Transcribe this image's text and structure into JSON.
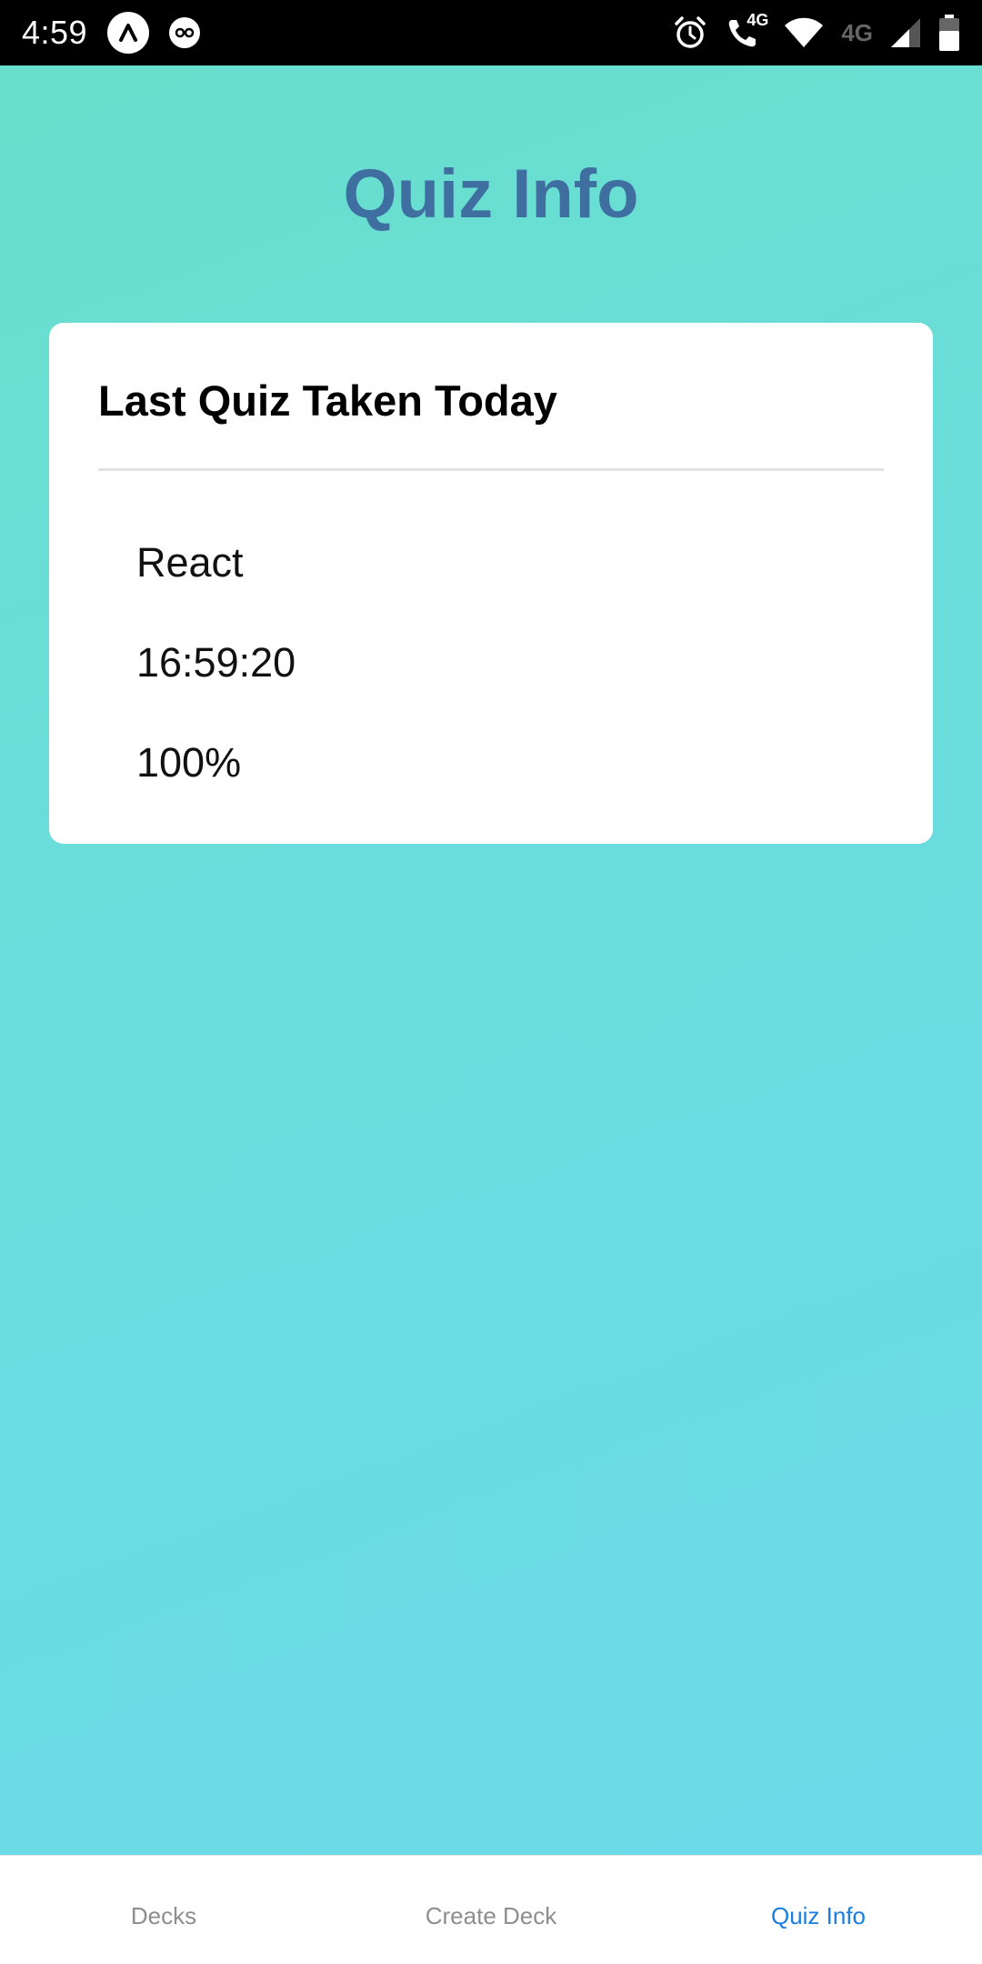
{
  "status_bar": {
    "time": "4:59",
    "left_icons": [
      "expo-icon",
      "go-icon"
    ],
    "right_icons": [
      "alarm-icon",
      "wifi-call-icon",
      "wifi-icon",
      "signal-icon",
      "battery-icon"
    ],
    "call_network": "4G",
    "network_label": "4G"
  },
  "page": {
    "title": "Quiz Info"
  },
  "card": {
    "title": "Last Quiz Taken Today",
    "deck": "React",
    "time": "16:59:20",
    "score": "100%"
  },
  "tabs": [
    {
      "label": "Decks",
      "active": false
    },
    {
      "label": "Create Deck",
      "active": false
    },
    {
      "label": "Quiz Info",
      "active": true
    }
  ],
  "colors": {
    "title": "#3f6fa0",
    "active_tab": "#1a7ee0",
    "inactive_tab": "#8e8e8e",
    "background": "#6ae0d0"
  }
}
